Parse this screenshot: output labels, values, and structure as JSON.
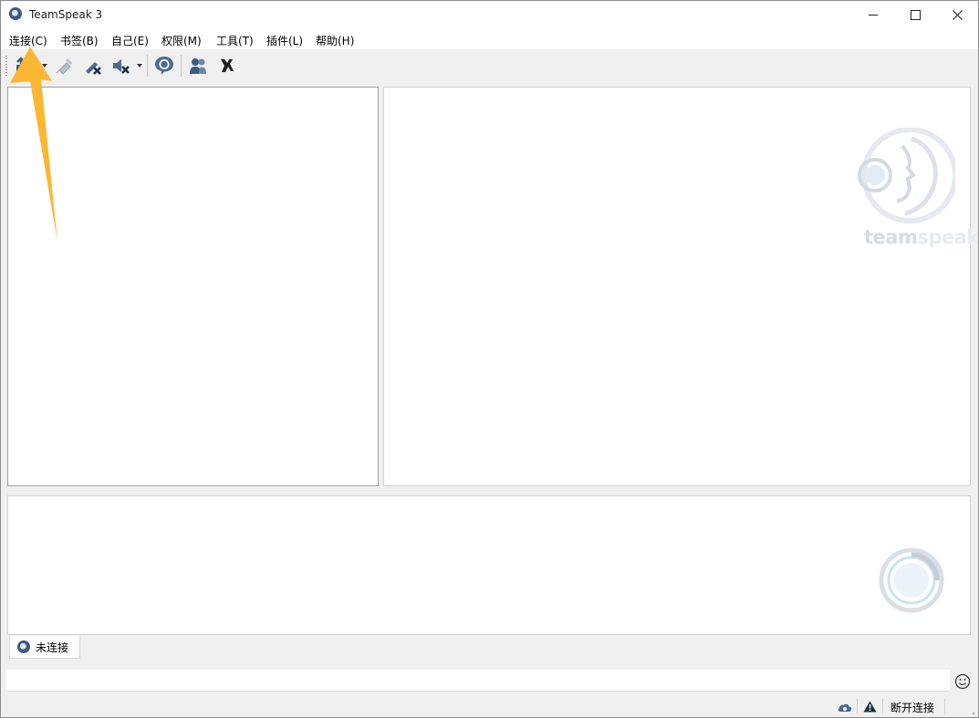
{
  "window": {
    "title": "TeamSpeak 3",
    "controls": [
      "minimize",
      "maximize",
      "close"
    ]
  },
  "menu": [
    {
      "label": "连接(C)"
    },
    {
      "label": "书签(B)"
    },
    {
      "label": "自己(E)"
    },
    {
      "label": "权限(M)"
    },
    {
      "label": "工具(T)"
    },
    {
      "label": "插件(L)"
    },
    {
      "label": "帮助(H)"
    }
  ],
  "toolbar": {
    "icons": [
      "connect-icon",
      "disconnect-icon",
      "away-icon",
      "mute-speakers-icon",
      "chat-icon",
      "contacts-icon",
      "whisper-icon"
    ]
  },
  "info_panel": {
    "logo_text_team": "team",
    "logo_text_speak": "speak"
  },
  "chat": {
    "tab_label": "未连接"
  },
  "input": {
    "value": "",
    "placeholder": ""
  },
  "status": {
    "connection_text": "断开连接"
  },
  "colors": {
    "accent": "#3c5a84",
    "annotation_arrow": "#fbb731"
  }
}
